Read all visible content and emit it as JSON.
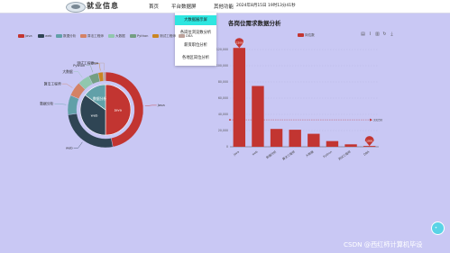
{
  "header": {
    "brand": "就业信息",
    "nav": [
      "首页",
      "平台数据屏",
      "其他功能"
    ],
    "datetime": "2024年8月15日 19时13分41秒"
  },
  "dropdown": {
    "items": [
      "大数据展示屏",
      "各岗位浏览数分析",
      "薪资职位分析",
      "各地区岗位分析"
    ],
    "active_index": 0
  },
  "pie_chart": {
    "legend": [
      "Java",
      "web",
      "数据分析",
      "算法工程师",
      "大数据",
      "Python",
      "测试工程师",
      "DBA"
    ],
    "colors": [
      "#c23531",
      "#2f4554",
      "#61a0a8",
      "#d48265",
      "#91c7ae",
      "#749f83",
      "#ca8622",
      "#bda29a"
    ],
    "outer_labels": [
      "Java",
      "web",
      "数据分析",
      "算法工程师",
      "大数据",
      "Python",
      "测试工程师",
      "DBA"
    ],
    "inner_labels": [
      "Java",
      "web",
      "数据分析"
    ]
  },
  "toolbox": {
    "icons": [
      "data-view-icon",
      "line-type-icon",
      "bar-type-icon",
      "restore-icon",
      "save-image-icon"
    ]
  },
  "bar_chart": {
    "title": "各岗位需求数据分析",
    "legend": "岗位数",
    "color": "#c23531"
  },
  "chart_data": [
    {
      "type": "pie",
      "series": [
        {
          "name": "outer",
          "values": [
            45,
            25,
            8,
            6,
            5,
            4,
            2,
            1
          ],
          "labels": [
            "Java",
            "web",
            "数据分析",
            "算法工程师",
            "大数据",
            "Python",
            "测试工程师",
            "DBA"
          ]
        },
        {
          "name": "inner",
          "values": [
            50,
            35,
            15
          ],
          "labels": [
            "Java",
            "web",
            "数据分析"
          ]
        }
      ]
    },
    {
      "type": "bar",
      "categories": [
        "Java",
        "web",
        "数据分析",
        "算法工程师",
        "大数据",
        "Python",
        "测试工程师",
        "DBA"
      ],
      "values": [
        122000,
        75000,
        22000,
        21000,
        16000,
        7000,
        3000,
        1000
      ],
      "ylim": [
        0,
        140000
      ],
      "yticks": [
        "0",
        "20,000",
        "40,000",
        "60,000",
        "80,000",
        "100,000",
        "120,000"
      ],
      "average_line": {
        "value": 33250,
        "label": "33250"
      },
      "markers": [
        {
          "label": "122000"
        },
        {
          "label": "1000"
        }
      ]
    }
  ],
  "footer": {
    "watermark": "CSDN @西红柿计算机毕设",
    "fab_icon": "assistant-icon"
  }
}
